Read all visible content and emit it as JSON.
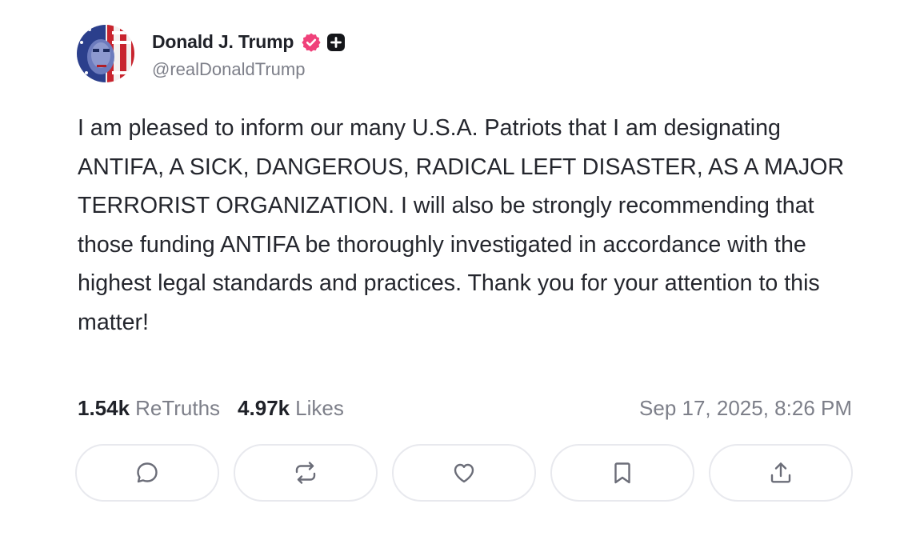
{
  "author": {
    "display_name": "Donald J. Trump",
    "handle": "@realDonaldTrump",
    "verified_badge_icon": "verified-check-icon",
    "verified_badge_color": "#f0417a",
    "plus_badge_icon": "plus-badge-icon"
  },
  "post": {
    "text": "I am pleased to inform our many U.S.A. Patriots that I am designating ANTIFA, A SICK, DANGEROUS, RADICAL LEFT DISASTER, AS A MAJOR TERRORIST ORGANIZATION. I will also be strongly recommending that those funding ANTIFA be thoroughly investigated in accordance with the highest legal standards and practices. Thank you for your attention to this matter!"
  },
  "stats": {
    "retruths_count": "1.54k",
    "retruths_label": "ReTruths",
    "likes_count": "4.97k",
    "likes_label": "Likes",
    "timestamp": "Sep 17, 2025, 8:26 PM"
  },
  "actions": [
    {
      "icon": "reply-icon"
    },
    {
      "icon": "retruth-icon"
    },
    {
      "icon": "like-heart-icon"
    },
    {
      "icon": "bookmark-icon"
    },
    {
      "icon": "share-upload-icon"
    }
  ],
  "colors": {
    "text_primary": "#1f2128",
    "text_secondary": "#7d7f89",
    "button_border": "#e8e9ee"
  }
}
